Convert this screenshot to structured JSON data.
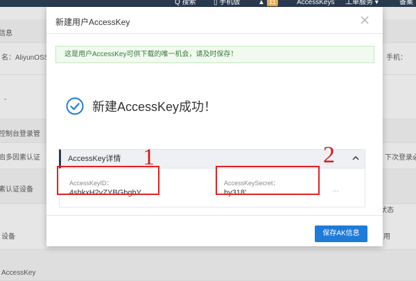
{
  "topbar": {
    "search": "Q 搜索",
    "mobile": "▯ 手机版",
    "bell_count": "11",
    "accesskeys": "AccessKeys",
    "ticket": "工单服务 ▾",
    "beian": "备案"
  },
  "background": {
    "row1_left": "信息",
    "row2_left": "名：AliyunOSST",
    "row2_right": "手机：",
    "row3_left": "-",
    "row4_left": "控制台登录管",
    "row5_left": "启多因素认证",
    "row5_right": "下次登录必",
    "row6_left": "素认证设备",
    "row6_right": "状态",
    "row7_left": "设备",
    "row7_right": "用",
    "row8_left": "AccessKey"
  },
  "modal": {
    "title": "新建用户AccessKey",
    "notice": "这是用户AccessKey可供下载的唯一机会，请及时保存！",
    "success_text": "新建AccessKey成功！",
    "details_title": "AccessKey详情",
    "key_id_label": "AccessKeyID：",
    "key_id_value": "4shkxH2vZYBGbgbY",
    "secret_label": "AccessKeySecret：",
    "secret_value": "hy318'",
    "save_button": "保存AK信息"
  },
  "annotations": {
    "one": "1",
    "two": "2"
  },
  "colors": {
    "topbar": "#2a3a4f",
    "accent": "#1f7bd8",
    "annotation": "#e02020",
    "notice_bg": "#f0faef"
  }
}
